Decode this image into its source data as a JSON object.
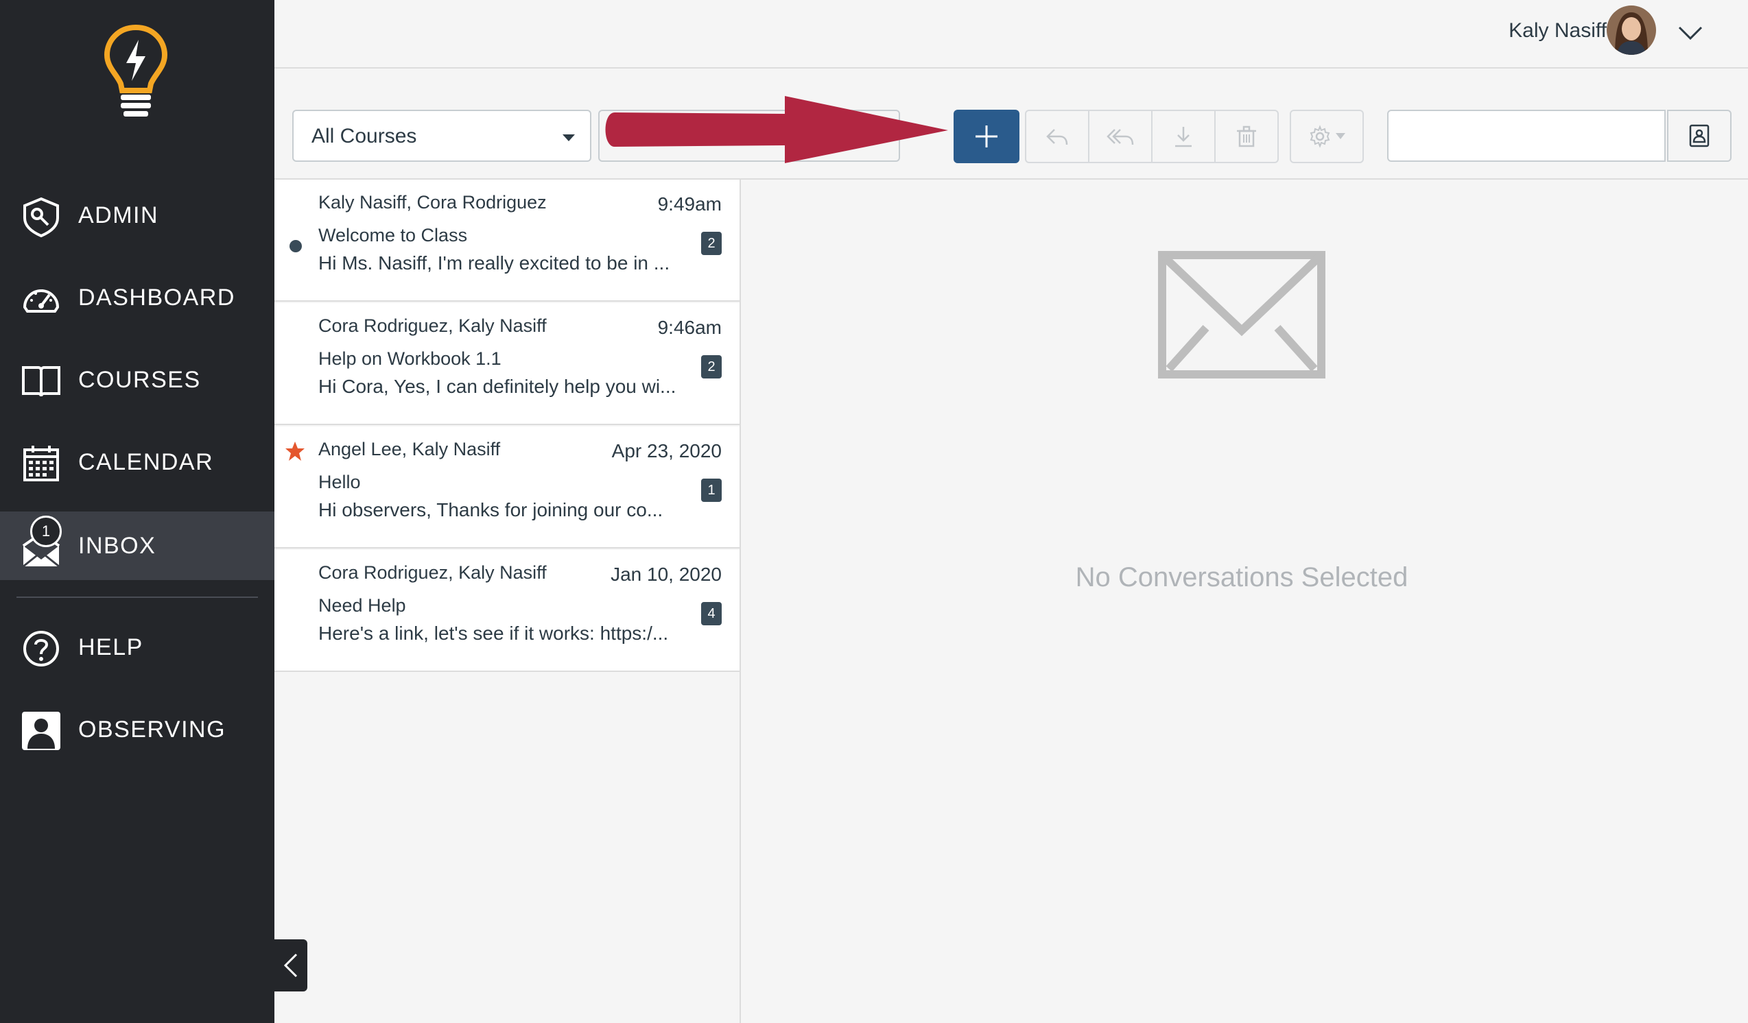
{
  "sidebar": {
    "items": [
      {
        "label": "ADMIN",
        "icon": "admin-shield-icon"
      },
      {
        "label": "DASHBOARD",
        "icon": "dashboard-gauge-icon"
      },
      {
        "label": "COURSES",
        "icon": "book-icon"
      },
      {
        "label": "CALENDAR",
        "icon": "calendar-icon"
      },
      {
        "label": "INBOX",
        "icon": "inbox-icon",
        "badge": "1"
      },
      {
        "label": "HELP",
        "icon": "help-circle-icon"
      },
      {
        "label": "OBSERVING",
        "icon": "observer-person-icon"
      }
    ]
  },
  "header": {
    "user_name": "Kaly Nasiff"
  },
  "toolbar": {
    "course_filter": "All Courses",
    "search_placeholder": ""
  },
  "conversations": [
    {
      "participants": "Kaly Nasiff, Cora Rodriguez",
      "date": "9:49am",
      "subject": "Welcome to Class",
      "preview": "Hi Ms. Nasiff, I'm really excited to be in ...",
      "count": "2",
      "unread": true,
      "starred": false
    },
    {
      "participants": "Cora Rodriguez, Kaly Nasiff",
      "date": "9:46am",
      "subject": "Help on Workbook 1.1",
      "preview": "Hi Cora, Yes, I can definitely help you wi...",
      "count": "2",
      "unread": false,
      "starred": false
    },
    {
      "participants": "Angel Lee, Kaly Nasiff",
      "date": "Apr 23, 2020",
      "subject": "Hello",
      "preview": "Hi observers, Thanks for joining our co...",
      "count": "1",
      "unread": false,
      "starred": true
    },
    {
      "participants": "Cora Rodriguez, Kaly Nasiff",
      "date": "Jan 10, 2020",
      "subject": "Need Help",
      "preview": "Here's a link, let's see if it works: https:/...",
      "count": "4",
      "unread": false,
      "starred": false
    }
  ],
  "message_pane": {
    "empty_text": "No Conversations Selected"
  },
  "colors": {
    "sidebar_bg": "#24262a",
    "accent_blue": "#2a5b8c",
    "logo_yellow": "#f4a623",
    "star_orange": "#e4572e",
    "arrow_red": "#b12641"
  }
}
